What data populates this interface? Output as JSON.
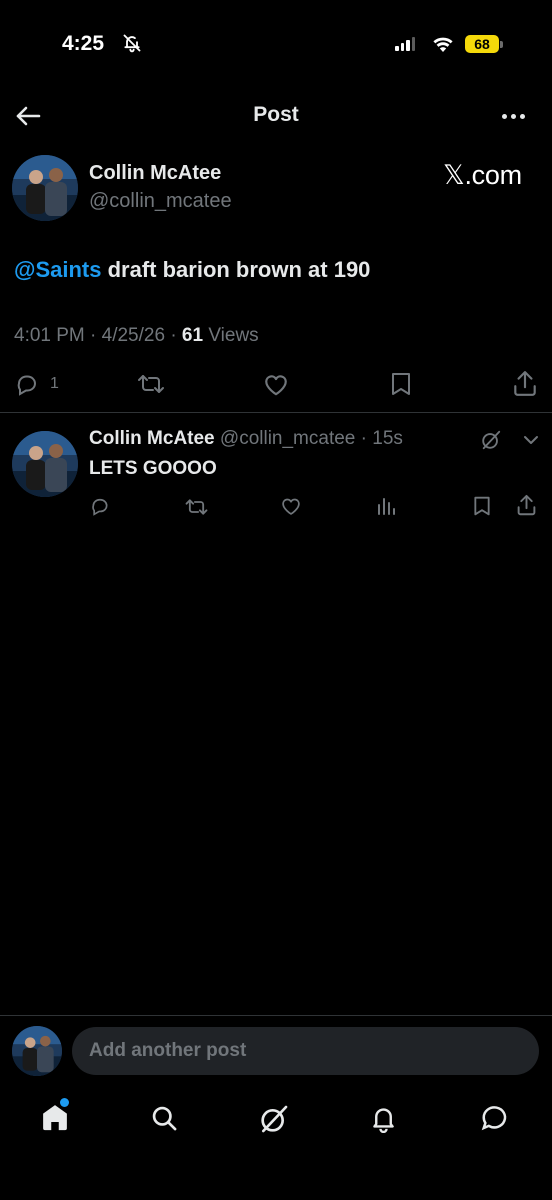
{
  "status_bar": {
    "time": "4:25",
    "battery": "68"
  },
  "header": {
    "title": "Post"
  },
  "post": {
    "author_name": "Collin McAtee",
    "author_handle": "@collin_mcatee",
    "source_badge": "𝕏.com",
    "mention": "@Saints",
    "text": " draft barion brown at 190",
    "timestamp": "4:01 PM · 4/25/26 · ",
    "views_count": "61",
    "views_label": " Views",
    "reply_count": "1"
  },
  "reply": {
    "author_name": "Collin McAtee",
    "author_handle": "@collin_mcatee",
    "time": " · 15s",
    "text": "LETS GOOOO"
  },
  "composer": {
    "placeholder": "Add another post"
  },
  "icons": {
    "back": "arrow-left-icon",
    "more": "more-icon",
    "reply": "reply-icon",
    "repost": "repost-icon",
    "like": "heart-icon",
    "bookmark": "bookmark-icon",
    "share": "share-icon",
    "views": "views-icon",
    "grok": "grok-icon",
    "tabs": [
      "home-icon",
      "search-icon",
      "grok-icon",
      "notifications-icon",
      "messages-icon"
    ]
  },
  "colors": {
    "accent": "#1d9bf0",
    "background": "#000000",
    "muted": "#71767b",
    "battery": "#f5d90a"
  }
}
